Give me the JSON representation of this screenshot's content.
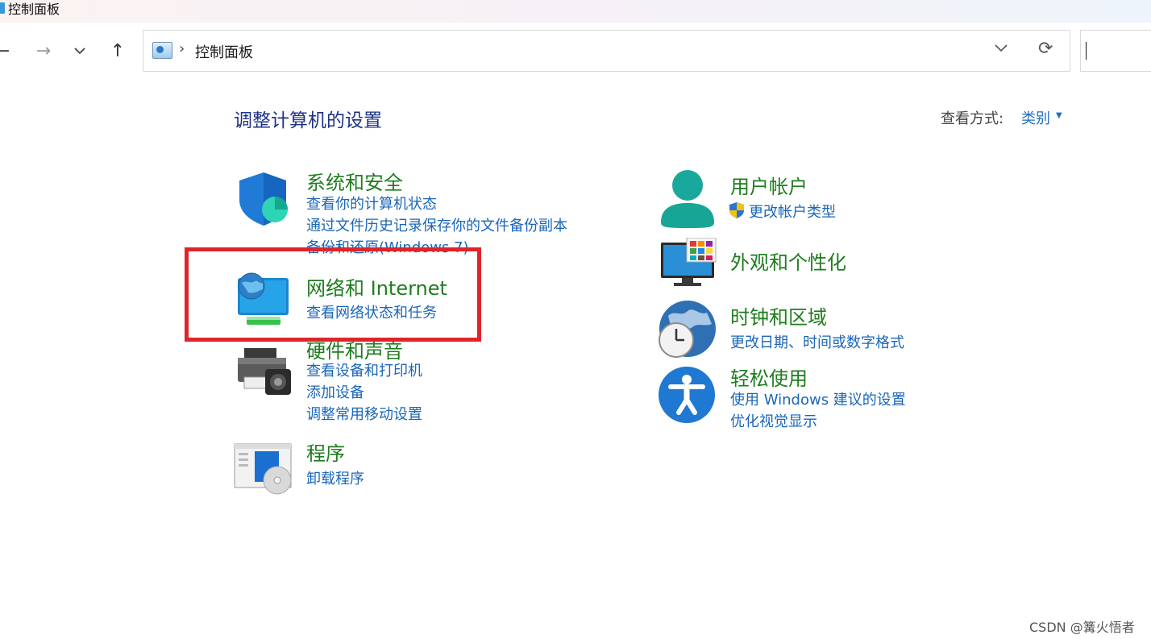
{
  "window": {
    "title": "控制面板"
  },
  "nav": {
    "address": {
      "crumb": "控制面板",
      "separator": "›"
    }
  },
  "header": {
    "page_title": "调整计算机的设置",
    "view_by_label": "查看方式:",
    "view_by_value": "类别"
  },
  "categories": [
    {
      "title": "系统和安全",
      "links": [
        "查看你的计算机状态",
        "通过文件历史记录保存你的文件备份副本",
        "备份和还原(Windows 7)"
      ]
    },
    {
      "title": "网络和 Internet",
      "links": [
        "查看网络状态和任务"
      ]
    },
    {
      "title": "硬件和声音",
      "links": [
        "查看设备和打印机",
        "添加设备",
        "调整常用移动设置"
      ]
    },
    {
      "title": "程序",
      "links": [
        "卸载程序"
      ]
    },
    {
      "title": "用户帐户",
      "links": [
        "更改帐户类型"
      ]
    },
    {
      "title": "外观和个性化",
      "links": []
    },
    {
      "title": "时钟和区域",
      "links": [
        "更改日期、时间或数字格式"
      ]
    },
    {
      "title": "轻松使用",
      "links": [
        "使用 Windows 建议的设置",
        "优化视觉显示"
      ]
    }
  ],
  "annotation": {
    "color": "#e0242a"
  },
  "colors": {
    "category_title": "#1e7d1e",
    "link": "#1a66b8",
    "page_title": "#1e3287"
  },
  "icons": [
    "shield-icon",
    "network-monitor-icon",
    "printer-icon",
    "programs-icon",
    "user-icon",
    "personalization-monitor-icon",
    "clock-globe-icon",
    "accessibility-icon",
    "uac-shield-icon"
  ],
  "watermark": "CSDN @篝火悟者"
}
